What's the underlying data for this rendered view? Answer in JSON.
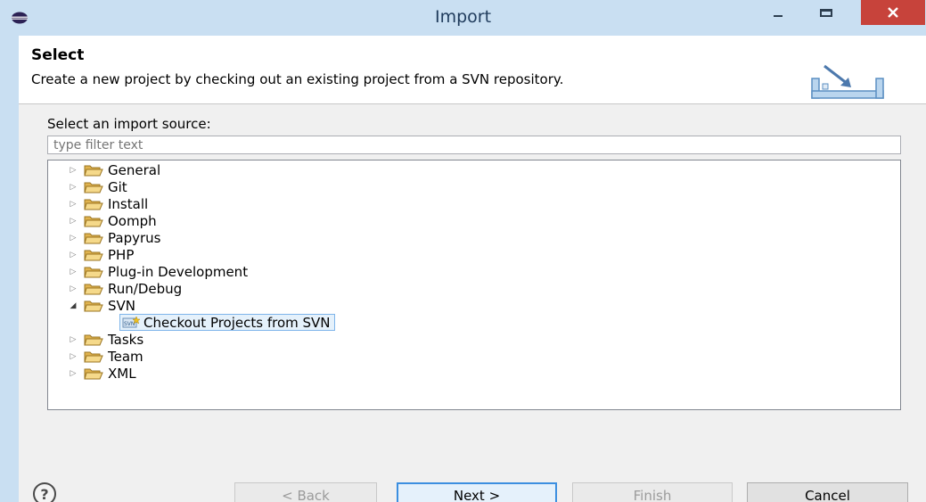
{
  "window": {
    "title": "Import",
    "titlebar_color": "#c9dff2",
    "close_color": "#c7433b"
  },
  "banner": {
    "title": "Select",
    "description": "Create a new project by checking out an existing project from a SVN repository."
  },
  "filter": {
    "label": "Select an import source:",
    "value": "",
    "placeholder": "type filter text"
  },
  "tree": {
    "items": [
      {
        "label": "General",
        "expanded": false,
        "icon": "folder-icon"
      },
      {
        "label": "Git",
        "expanded": false,
        "icon": "folder-icon"
      },
      {
        "label": "Install",
        "expanded": false,
        "icon": "folder-icon"
      },
      {
        "label": "Oomph",
        "expanded": false,
        "icon": "folder-icon"
      },
      {
        "label": "Papyrus",
        "expanded": false,
        "icon": "folder-icon"
      },
      {
        "label": "PHP",
        "expanded": false,
        "icon": "folder-icon"
      },
      {
        "label": "Plug-in Development",
        "expanded": false,
        "icon": "folder-icon"
      },
      {
        "label": "Run/Debug",
        "expanded": false,
        "icon": "folder-icon"
      },
      {
        "label": "SVN",
        "expanded": true,
        "icon": "folder-icon"
      },
      {
        "label": "Tasks",
        "expanded": false,
        "icon": "folder-icon"
      },
      {
        "label": "Team",
        "expanded": false,
        "icon": "folder-icon"
      },
      {
        "label": "XML",
        "expanded": false,
        "icon": "folder-icon"
      }
    ],
    "selected_child": {
      "label": "Checkout Projects from SVN",
      "icon": "svn-checkout-icon"
    }
  },
  "footer": {
    "help_label": "?",
    "back_label": "< Back",
    "next_label": "Next >",
    "finish_label": "Finish",
    "cancel_label": "Cancel"
  }
}
